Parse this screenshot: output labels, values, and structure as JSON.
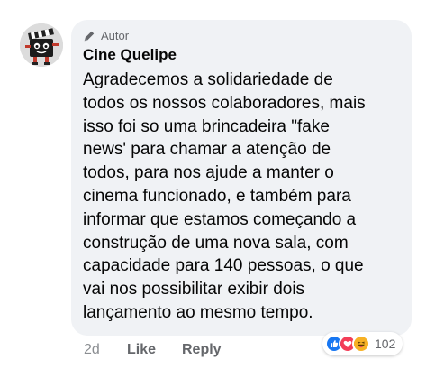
{
  "comment": {
    "badge_label": "Autor",
    "author_name": "Cine Quelipe",
    "text": "Agradecemos a solidariedade de\ntodos os nossos colaboradores, mais\nisso foi so uma brincadeira \"fake\nnews' para chamar a atenção de\ntodos, para  nos ajude a manter o\ncinema funcionado, e também para\ninformar que estamos começando a\nconstrução de uma nova sala, com\ncapacidade para 140 pessoas, o que\nvai nos possibilitar exibir dois\nlançamento ao mesmo tempo.",
    "timestamp": "2d",
    "like_label": "Like",
    "reply_label": "Reply",
    "reactions": {
      "types": [
        "like-icon",
        "love-icon",
        "haha-icon"
      ],
      "count": "102"
    }
  },
  "colors": {
    "bubble_bg": "#f0f2f5",
    "text": "#050505",
    "muted": "#65676b",
    "like_blue": "#1877f2",
    "love_red": "#f33e58",
    "haha_yellow": "#f7b125"
  }
}
